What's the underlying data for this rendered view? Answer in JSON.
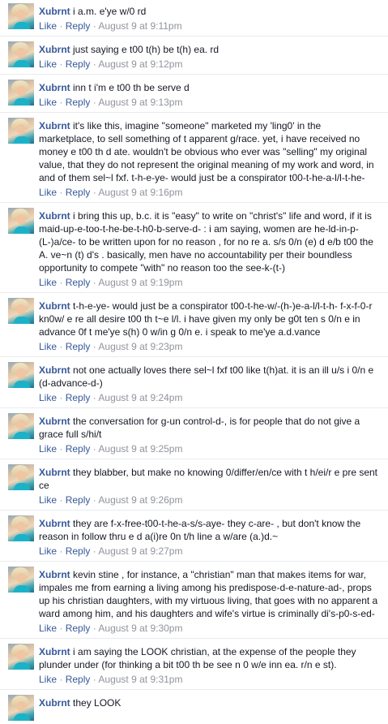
{
  "actions": {
    "like": "Like",
    "reply": "Reply",
    "separator": "·"
  },
  "comments": [
    {
      "author": "Xubrnt",
      "text": "i a.m. e'ye w/0 rd",
      "time": "August 9 at 9:11pm"
    },
    {
      "author": "Xubrnt",
      "text": "just saying e t00 t(h) be t(h) ea. rd",
      "time": "August 9 at 9:12pm"
    },
    {
      "author": "Xubrnt",
      "text": "inn t i'm e t00 th be serve d",
      "time": "August 9 at 9:13pm"
    },
    {
      "author": "Xubrnt",
      "text": "it's like this, imagine \"someone\" marketed my 'ling0' in the marketplace, to sell something of t apparent g/race. yet, i have received no money e t00 th d ate. wouldn't be obvious who ever was \"selling\" my original value, that they do not represent the original meaning of my work and word, in and of them sel~l fxf. t-h-e-ye- would just be a conspirator t00-t-he-a-l/l-t-he-",
      "time": "August 9 at 9:16pm"
    },
    {
      "author": "Xubrnt",
      "text": "i bring this up, b.c. it is \"easy\" to write on \"christ's\" life and word, if it is maid-up-e-too-t-he-be-t-h0-b-serve-d- : i am saying, women are he-ld-in-p-(L-)a/ce- to be written upon for no reason , for no re a. s/s 0/n (e) d e/b t00 the A. ve~n (t) d's . basically, men have no accountability per their boundless opportunity to compete \"with\" no reason too the see-k-(t-)",
      "time": "August 9 at 9:19pm"
    },
    {
      "author": "Xubrnt",
      "text": "t-h-e-ye- would just be a conspirator t00-t-he-w/-(h-)e-a-l/l-t-h- f-x-f-0-r kn0w/ e re all desire t00 th t~e l/l. i have given my only be g0t ten s 0/n e in advance 0f t me'ye s(h) 0 w/in g 0/n e. i speak to me'ye a.d.vance",
      "time": "August 9 at 9:23pm"
    },
    {
      "author": "Xubrnt",
      "text": "not one actually loves there sel~l fxf t00 like t(h)at. it is an ill u/s i 0/n e (d-advance-d-)",
      "time": "August 9 at 9:24pm"
    },
    {
      "author": "Xubrnt",
      "text": "the conversation for g-un control-d-, is for people that do not give a grace full s/hi/t",
      "time": "August 9 at 9:25pm"
    },
    {
      "author": "Xubrnt",
      "text": "they blabber, but make no knowing 0/differ/en/ce with t h/ei/r e pre sent ce",
      "time": "August 9 at 9:26pm"
    },
    {
      "author": "Xubrnt",
      "text": "they are f-x-free-t00-t-he-a-s/s-aye- they c-are- , but don't know the reason in follow thru e d a(i)re 0n t/h line a w/are (a.)d.~",
      "time": "August 9 at 9:27pm"
    },
    {
      "author": "Xubrnt",
      "text": "kevin stine , for instance, a \"christian\" man that makes items for war, impales me from earning a living among his predispose-d-e-nature-ad-, props up his christian daughters, with my virtuous living, that goes with no apparent a ward among him, and his daughters and wife's virtue is criminally di's-p0-s-ed-",
      "time": "August 9 at 9:30pm"
    },
    {
      "author": "Xubrnt",
      "text": "i am saying the LOOK christian, at the expense of the people they plunder under (for thinking a bit t00 th be see n 0 w/e inn ea. r/n e st).",
      "time": "August 9 at 9:31pm"
    },
    {
      "author": "Xubrnt",
      "text": "they LOOK",
      "time": ""
    }
  ]
}
